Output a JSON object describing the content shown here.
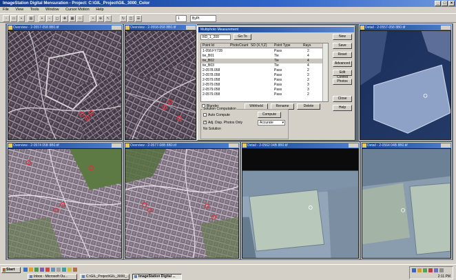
{
  "window": {
    "title": "ImageStation Digital Mensuration - Project: C:\\GIL_Project\\GIL_3000_Color",
    "controls": [
      "_",
      "□",
      "×"
    ]
  },
  "menu": [
    "File",
    "View",
    "Tools",
    "Window",
    "Cursor Motion",
    "Help"
  ],
  "toolbar": {
    "zoom_value": "1",
    "mode_value": "ByPt",
    "icons": [
      "new-icon",
      "open-icon",
      "save-icon",
      "print-icon",
      "zoom-in-icon",
      "zoom-out-icon",
      "fit-icon",
      "pan-icon",
      "overview-icon",
      "measure-icon",
      "point-icon",
      "tie-icon",
      "select-icon",
      "refresh-icon",
      "stereo-icon",
      "options-icon"
    ]
  },
  "windows": [
    {
      "title": "Overview - 2-0557-058 8B0.tif",
      "scene": "city"
    },
    {
      "title": "Overview - 2-0558-058 8B0.tif",
      "scene": "city"
    },
    {
      "title": "Detail - 2-0557-058 8B0.tif",
      "scene": "detail-dark"
    },
    {
      "title": "Overview - 2-0574 05B 8B0.tif",
      "scene": "city-color"
    },
    {
      "title": "Overview - 2-0577-08B 8B0.tif",
      "scene": "city-color"
    },
    {
      "title": "Detail - 2-0562 04B 8B0.tif",
      "scene": "field"
    },
    {
      "title": "Detail - 2-0564 04B 8B0.tif",
      "scene": "field"
    }
  ],
  "dialog": {
    "title": "Multiphoto Measurement",
    "point_field": "RD_1_200",
    "goto_label": "Go To",
    "columns": [
      "Point Id",
      "PhotoCount",
      "SD (X,Y,Z)",
      "Point Type",
      "Rays"
    ],
    "rows": [
      {
        "id": "1-058.FY728",
        "type": "Pass",
        "rays": "2"
      },
      {
        "id": "tie_B01",
        "type": "Tie",
        "rays": "4"
      },
      {
        "id": "tie_B02",
        "type": "Tie",
        "rays": "4"
      },
      {
        "id": "tie_B03",
        "type": "Tie",
        "rays": "4"
      },
      {
        "id": "2-0578.058",
        "type": "Pass",
        "rays": "2"
      },
      {
        "id": "2-0578.058",
        "type": "Pass",
        "rays": "2"
      },
      {
        "id": "2-0579.058",
        "type": "Pass",
        "rays": "2"
      },
      {
        "id": "2-0579.058",
        "type": "Pass",
        "rays": "3"
      },
      {
        "id": "2-0579.058",
        "type": "Pass",
        "rays": "3"
      },
      {
        "id": "2-0579.058",
        "type": "Pass",
        "rays": "2"
      }
    ],
    "side_buttons": [
      "New",
      "Save",
      "Reset",
      "Advanced",
      "Edit Control",
      "Photos",
      "Close",
      "Help"
    ],
    "action_buttons": [
      "Withheld",
      "Rename",
      "Delete"
    ],
    "flag_label": "Blunder",
    "group_title": "Solution Computation",
    "auto_compute_label": "Auto Compute",
    "adjust_label": "Adj. Disp. Photos Only",
    "no_solution": "No Solution",
    "compute_label": "Compute",
    "method_value": "Accurate"
  },
  "taskbar": {
    "start_label": "Start",
    "tasks": [
      "Inbox - Microsoft Ou...",
      "C:\\GIL_Project\\GIL_3000_...",
      "ImageStation Digital ..."
    ],
    "active_task_index": 2,
    "clock": "2:11 PM"
  }
}
